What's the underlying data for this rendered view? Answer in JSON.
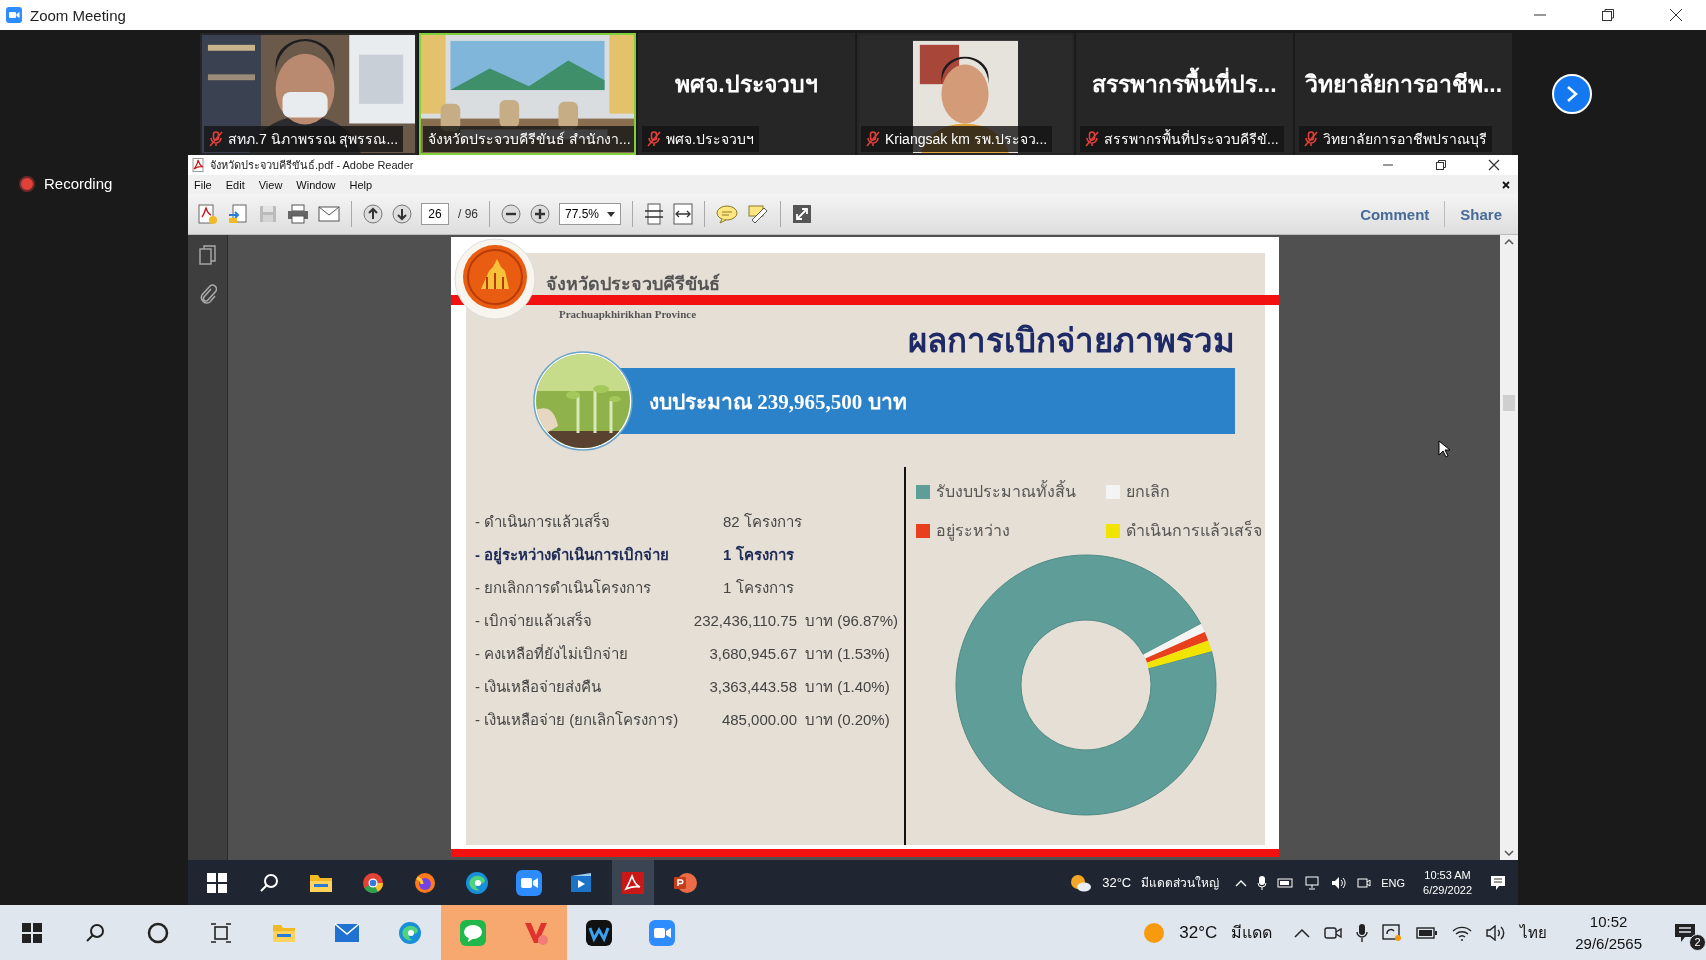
{
  "window": {
    "title": "Zoom Meeting"
  },
  "participants": [
    {
      "kind": "video",
      "name": "สทภ.7 นิภาพรรณ สุพรรณ...",
      "muted": true,
      "speaking": false
    },
    {
      "kind": "video",
      "name": "จังหวัดประจวบคีรีขันธ์ สำนักงา...",
      "muted": false,
      "speaking": true
    },
    {
      "kind": "name",
      "display": "พศจ.ประจวบฯ",
      "name": "พศจ.ประจวบฯ",
      "muted": true,
      "speaking": false
    },
    {
      "kind": "video",
      "name": "Kriangsak km รพ.ประจว...",
      "muted": true,
      "speaking": false
    },
    {
      "kind": "name",
      "display": "สรรพากรพื้นที่ปร...",
      "name": "สรรพากรพื้นที่ประจวบคีรีขั...",
      "muted": true,
      "speaking": false
    },
    {
      "kind": "name",
      "display": "วิทยาลัยการอาชีพ...",
      "name": "วิทยาลัยการอาชีพปราณบุรี",
      "muted": true,
      "speaking": false
    }
  ],
  "recording": {
    "label": "Recording"
  },
  "reader": {
    "title": "จังหวัดประจวบคีรีขันธ์.pdf - Adobe Reader",
    "menu": [
      "File",
      "Edit",
      "View",
      "Window",
      "Help"
    ],
    "page": "26",
    "page_count": "/ 96",
    "zoom": "77.5%",
    "actions": [
      "Comment",
      "Share"
    ]
  },
  "slide": {
    "province_th": "จังหวัดประจวบคีรีขันธ์",
    "province_en": "Prachuapkhirikhan Province",
    "heading": "ผลการเบิกจ่ายภาพรวม",
    "budget": "งบประมาณ 239,965,500 บาท",
    "rows": [
      {
        "label": "- ดำเนินการแล้วเสร็จ",
        "value": "82 โครงการ",
        "bold": false
      },
      {
        "label": "- อยู่ระหว่างดำเนินการเบิกจ่าย",
        "value": "1 โครงการ",
        "bold": true
      },
      {
        "label": "- ยกเลิกการดำเนินโครงการ",
        "value": "1 โครงการ",
        "bold": false
      },
      {
        "label": "- เบิกจ่ายแล้วเสร็จ",
        "value": "232,436,110.75",
        "unit": "บาท (96.87%)",
        "bold": false
      },
      {
        "label": "- คงเหลือที่ยังไม่เบิกจ่าย",
        "value": "3,680,945.67",
        "unit": "บาท (1.53%)",
        "bold": false
      },
      {
        "label": "- เงินเหลือจ่ายส่งคืน",
        "value": "3,363,443.58",
        "unit": "บาท (1.40%)",
        "bold": false
      },
      {
        "label": "- เงินเหลือจ่าย (ยกเลิกโครงการ)",
        "value": "485,000.00",
        "unit": "บาท (0.20%)",
        "bold": false
      }
    ],
    "legend": [
      {
        "label": "รับงบประมาณทั้งสิ้น",
        "color": "#5f9e98"
      },
      {
        "label": "ยกเลิก",
        "color": "#f4f4f4"
      },
      {
        "label": "อยู่ระหว่าง",
        "color": "#e8401c"
      },
      {
        "label": "ดำเนินการแล้วเสร็จ",
        "color": "#f0e400"
      }
    ]
  },
  "shared_taskbar": {
    "apps": [
      {
        "kind": "start",
        "active": false
      },
      {
        "kind": "search",
        "active": false
      },
      {
        "kind": "explorer",
        "active": false
      },
      {
        "kind": "chrome",
        "active": false
      },
      {
        "kind": "firefox",
        "active": false
      },
      {
        "kind": "edge",
        "active": false
      },
      {
        "kind": "zoom",
        "active": false
      },
      {
        "kind": "video",
        "active": false
      },
      {
        "kind": "acrobat",
        "active": true
      },
      {
        "kind": "powerpoint",
        "active": false
      }
    ],
    "temperature": "32°C",
    "weather": "มีแดดส่วนใหญ่",
    "language": "ENG",
    "time": "10:53 AM",
    "date": "6/29/2022"
  },
  "taskbar": {
    "apps": [
      {
        "kind": "start",
        "active": false
      },
      {
        "kind": "search",
        "active": false
      },
      {
        "kind": "cortana",
        "active": false
      },
      {
        "kind": "taskview",
        "active": false
      },
      {
        "kind": "explorer",
        "active": false
      },
      {
        "kind": "mail",
        "active": false
      },
      {
        "kind": "edge",
        "active": false
      },
      {
        "kind": "line",
        "active": true
      },
      {
        "kind": "vivaldi",
        "active": true
      },
      {
        "kind": "webex",
        "active": false
      },
      {
        "kind": "zoom",
        "active": false
      }
    ],
    "temperature": "32°C",
    "weather": "มีแดด",
    "language": "ไทย",
    "time": "10:52",
    "date": "29/6/2565",
    "notifications": "2"
  }
}
